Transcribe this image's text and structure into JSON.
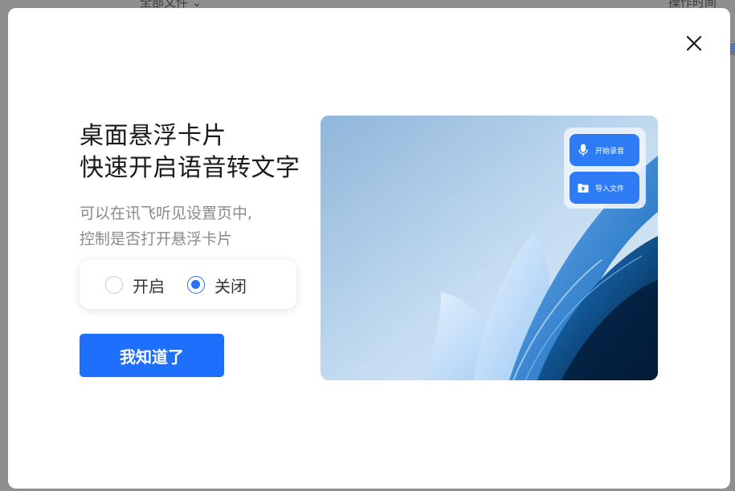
{
  "background": {
    "all_files_label": "全部文件 ⌄",
    "operation_time_label": "操作时间",
    "right_fragment": "管"
  },
  "modal": {
    "title_line1": "桌面悬浮卡片",
    "title_line2": "快速开启语音转文字",
    "desc_line1": "可以在讯飞听见设置页中,",
    "desc_line2": "控制是否打开悬浮卡片",
    "radio": {
      "selected": "关闭",
      "options": [
        {
          "label": "开启",
          "checked": false
        },
        {
          "label": "关闭",
          "checked": true
        }
      ]
    },
    "ok_button_label": "我知道了",
    "preview": {
      "record_label": "开始录音",
      "import_label": "导入文件"
    }
  },
  "colors": {
    "primary": "#1e6ffb",
    "radio_checked": "#2b6ff3",
    "overlay": "#8f8f8f"
  }
}
